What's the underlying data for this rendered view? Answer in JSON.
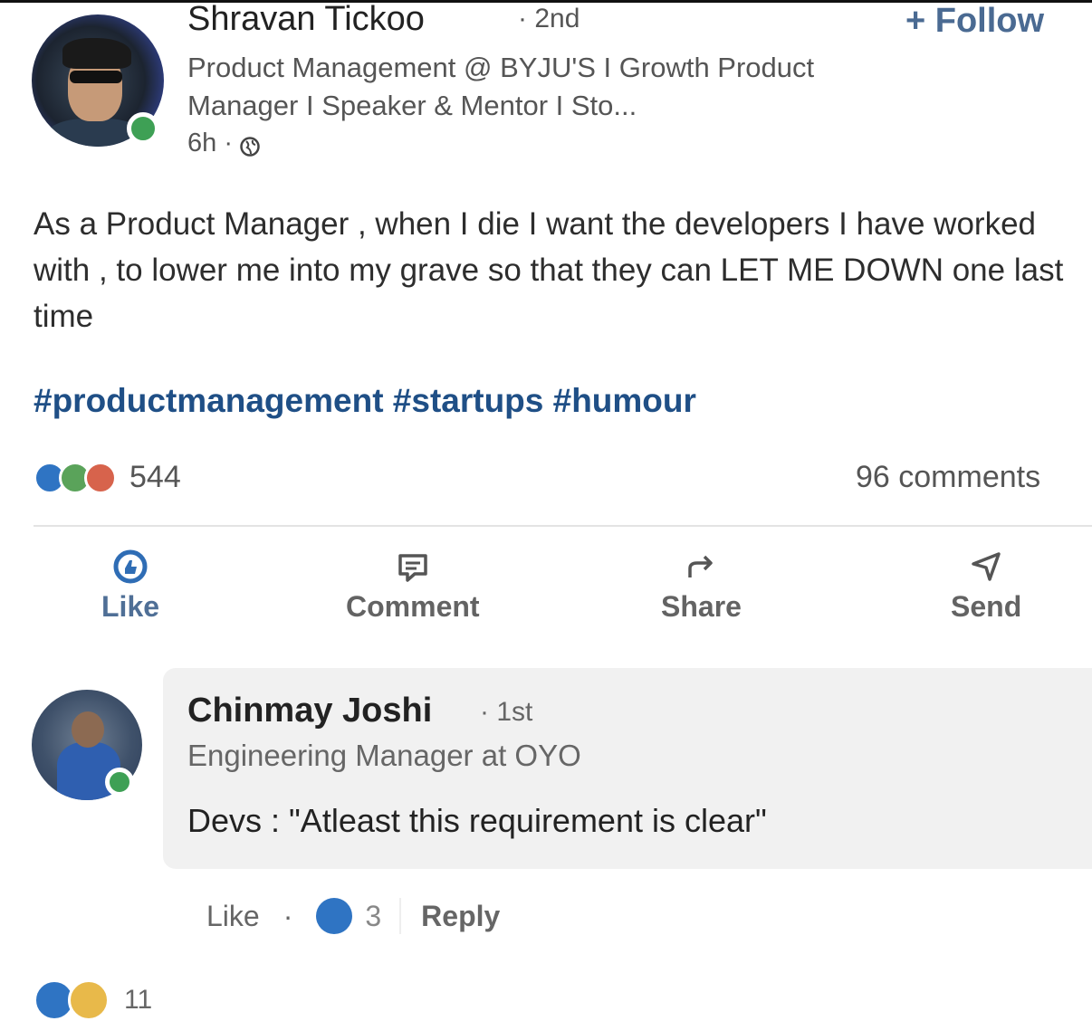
{
  "post": {
    "author": {
      "name": "Shravan Tickoo",
      "degree": "· 2nd",
      "headline": "Product Management @ BYJU'S I Growth Product Manager I Speaker & Mentor I Sto...",
      "time": "6h ·"
    },
    "follow_label": "+ Follow",
    "text": "As a Product Manager , when I die I want the developers I have worked with , to lower me into my grave so that they can LET ME DOWN one last time",
    "hashtags": "#productmanagement #startups #humour",
    "reaction_count": "544",
    "comments_count": "96 comments",
    "actions": {
      "like": "Like",
      "comment": "Comment",
      "share": "Share",
      "send": "Send"
    }
  },
  "comment": {
    "author": "Chinmay Joshi",
    "degree": "· 1st",
    "headline": "Engineering Manager at OYO",
    "text": "Devs : \"Atleast this requirement is clear\"",
    "like_label": "Like",
    "separator": "·",
    "like_count": "3",
    "reply_label": "Reply"
  },
  "next_item": {
    "reaction_count": "11"
  },
  "colors": {
    "like_blue": "#2f74c3",
    "celebrate_green": "#5aa35a",
    "love_red": "#d7634c",
    "hashtag_blue": "#1f4f86",
    "online_green": "#3ea055"
  },
  "icons": {
    "like": "thumbs-up-icon",
    "comment": "speech-bubble-icon",
    "share": "share-arrow-icon",
    "send": "paper-plane-icon",
    "visibility": "globe-icon"
  }
}
